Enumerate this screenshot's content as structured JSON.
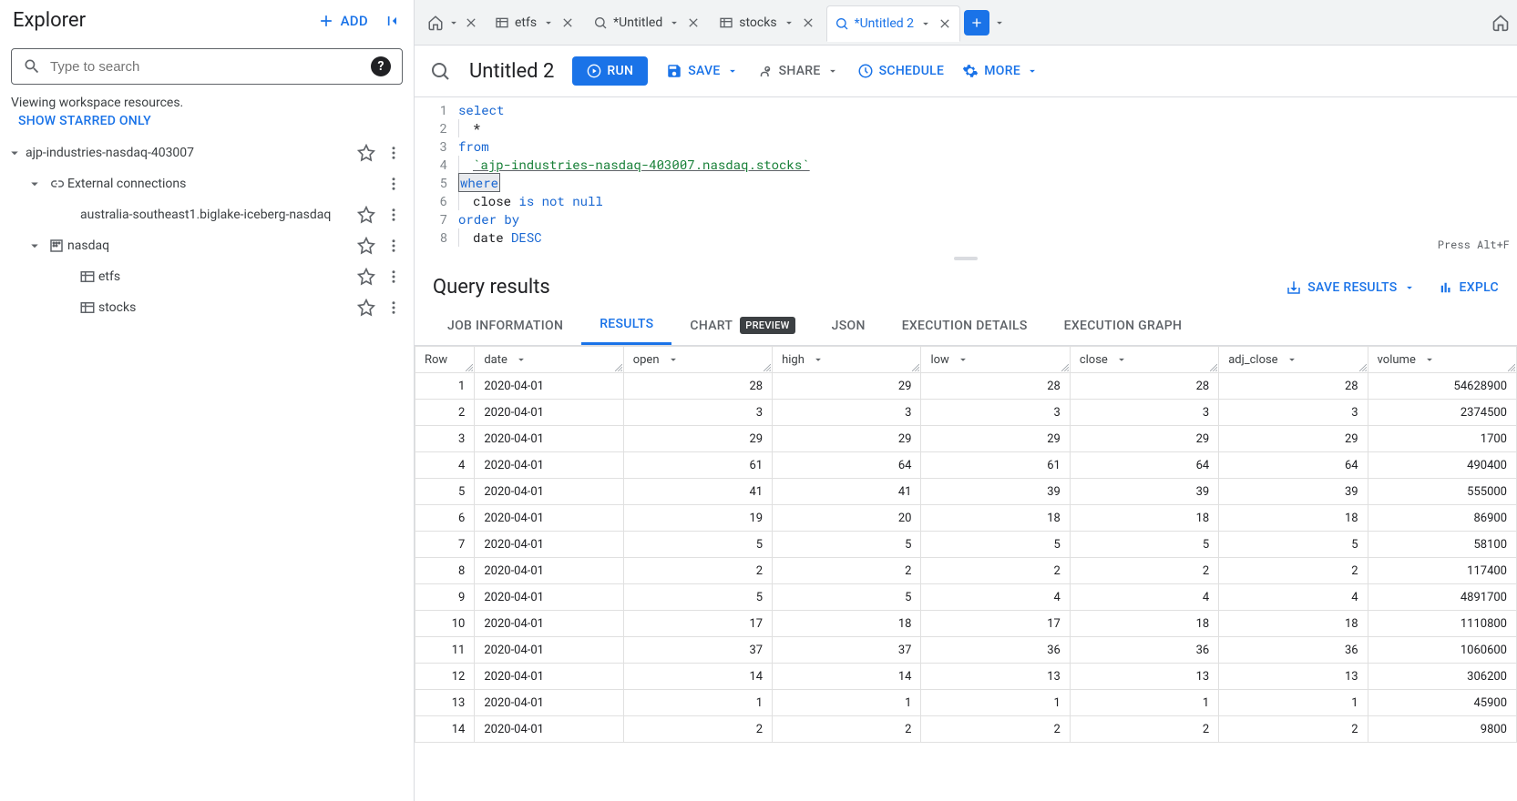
{
  "sidebar": {
    "title": "Explorer",
    "add_label": "ADD",
    "search_placeholder": "Type to search",
    "viewing_text": "Viewing workspace resources.",
    "show_starred": "SHOW STARRED ONLY",
    "tree": {
      "project": "ajp-industries-nasdaq-403007",
      "external": "External connections",
      "external_item": "australia-southeast1.biglake-iceberg-nasdaq",
      "dataset": "nasdaq",
      "table1": "etfs",
      "table2": "stocks"
    }
  },
  "tabs": {
    "open": [
      {
        "icon": "table",
        "label": "etfs"
      },
      {
        "icon": "query",
        "label": "*Untitled"
      },
      {
        "icon": "table",
        "label": "stocks"
      },
      {
        "icon": "query",
        "label": "*Untitled 2",
        "active": true
      }
    ]
  },
  "editor": {
    "title": "Untitled 2",
    "run": "RUN",
    "save": "SAVE",
    "share": "SHARE",
    "schedule": "SCHEDULE",
    "more": "MORE",
    "press_hint": "Press Alt+F",
    "sql": {
      "l1_kw": "select",
      "l2": "*",
      "l3_kw": "from",
      "l4_str": "`ajp-industries-nasdaq-403007.nasdaq.stocks`",
      "l5_kw": "where",
      "l6_col": "close ",
      "l6_op": "is not null",
      "l7_kw": "order by",
      "l8_col": "date ",
      "l8_kw": "DESC"
    }
  },
  "results": {
    "title": "Query results",
    "save": "SAVE RESULTS",
    "explore": "EXPLC",
    "tabs": {
      "job": "JOB INFORMATION",
      "results": "RESULTS",
      "chart": "CHART",
      "preview": "PREVIEW",
      "json": "JSON",
      "exec": "EXECUTION DETAILS",
      "graph": "EXECUTION GRAPH"
    },
    "columns": [
      "Row",
      "date",
      "open",
      "high",
      "low",
      "close",
      "adj_close",
      "volume"
    ],
    "rows": [
      {
        "row": "1",
        "date": "2020-04-01",
        "open": "28",
        "high": "29",
        "low": "28",
        "close": "28",
        "adj_close": "28",
        "volume": "54628900"
      },
      {
        "row": "2",
        "date": "2020-04-01",
        "open": "3",
        "high": "3",
        "low": "3",
        "close": "3",
        "adj_close": "3",
        "volume": "2374500"
      },
      {
        "row": "3",
        "date": "2020-04-01",
        "open": "29",
        "high": "29",
        "low": "29",
        "close": "29",
        "adj_close": "29",
        "volume": "1700"
      },
      {
        "row": "4",
        "date": "2020-04-01",
        "open": "61",
        "high": "64",
        "low": "61",
        "close": "64",
        "adj_close": "64",
        "volume": "490400"
      },
      {
        "row": "5",
        "date": "2020-04-01",
        "open": "41",
        "high": "41",
        "low": "39",
        "close": "39",
        "adj_close": "39",
        "volume": "555000"
      },
      {
        "row": "6",
        "date": "2020-04-01",
        "open": "19",
        "high": "20",
        "low": "18",
        "close": "18",
        "adj_close": "18",
        "volume": "86900"
      },
      {
        "row": "7",
        "date": "2020-04-01",
        "open": "5",
        "high": "5",
        "low": "5",
        "close": "5",
        "adj_close": "5",
        "volume": "58100"
      },
      {
        "row": "8",
        "date": "2020-04-01",
        "open": "2",
        "high": "2",
        "low": "2",
        "close": "2",
        "adj_close": "2",
        "volume": "117400"
      },
      {
        "row": "9",
        "date": "2020-04-01",
        "open": "5",
        "high": "5",
        "low": "4",
        "close": "4",
        "adj_close": "4",
        "volume": "4891700"
      },
      {
        "row": "10",
        "date": "2020-04-01",
        "open": "17",
        "high": "18",
        "low": "17",
        "close": "18",
        "adj_close": "18",
        "volume": "1110800"
      },
      {
        "row": "11",
        "date": "2020-04-01",
        "open": "37",
        "high": "37",
        "low": "36",
        "close": "36",
        "adj_close": "36",
        "volume": "1060600"
      },
      {
        "row": "12",
        "date": "2020-04-01",
        "open": "14",
        "high": "14",
        "low": "13",
        "close": "13",
        "adj_close": "13",
        "volume": "306200"
      },
      {
        "row": "13",
        "date": "2020-04-01",
        "open": "1",
        "high": "1",
        "low": "1",
        "close": "1",
        "adj_close": "1",
        "volume": "45900"
      },
      {
        "row": "14",
        "date": "2020-04-01",
        "open": "2",
        "high": "2",
        "low": "2",
        "close": "2",
        "adj_close": "2",
        "volume": "9800"
      }
    ]
  }
}
